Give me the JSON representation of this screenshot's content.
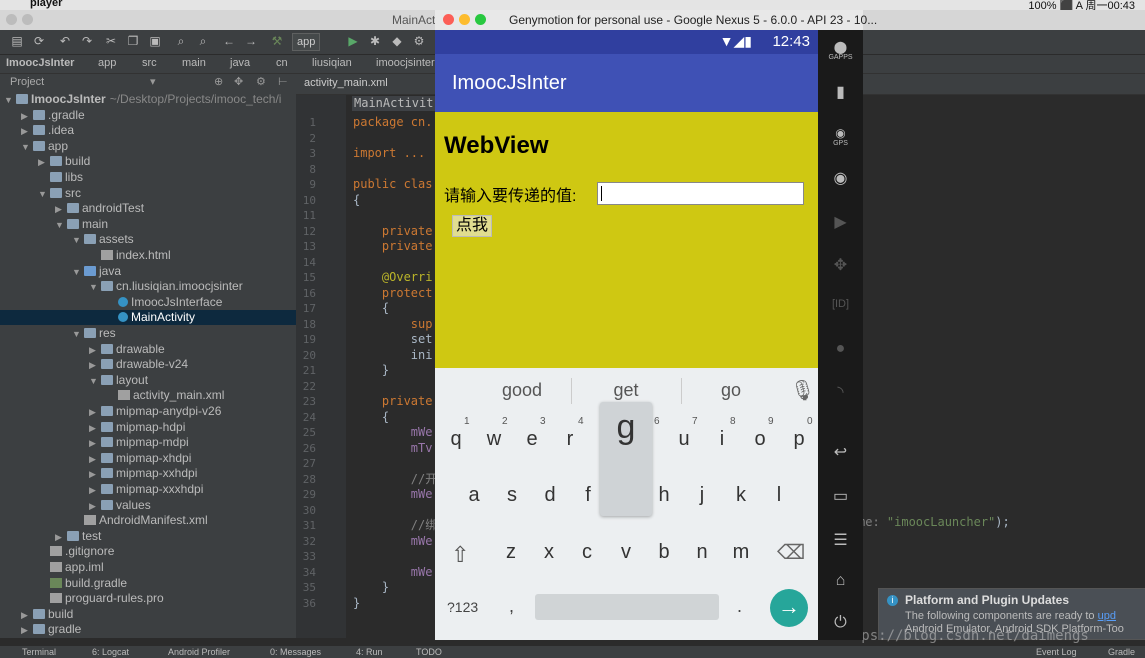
{
  "mac": {
    "app_name": "player",
    "right": "100%  ⬛  A  周一00:43"
  },
  "studio": {
    "window_title": "MainActi"
  },
  "toolbar": {
    "config": "app"
  },
  "breadcrumbs": [
    "ImoocJsInter",
    "app",
    "src",
    "main",
    "java",
    "cn",
    "liusiqian",
    "imoocjsinter"
  ],
  "project": {
    "view_label": "Project",
    "tree": [
      {
        "label": "ImoocJsInter",
        "suffix": "~/Desktop/Projects/imooc_tech/i",
        "depth": 0,
        "arrow": "▼",
        "icon": "folder"
      },
      {
        "label": ".gradle",
        "depth": 1,
        "arrow": "▶",
        "icon": "folder"
      },
      {
        "label": ".idea",
        "depth": 1,
        "arrow": "▶",
        "icon": "folder"
      },
      {
        "label": "app",
        "depth": 1,
        "arrow": "▼",
        "icon": "folder"
      },
      {
        "label": "build",
        "depth": 2,
        "arrow": "▶",
        "icon": "folder"
      },
      {
        "label": "libs",
        "depth": 2,
        "arrow": "",
        "icon": "folder"
      },
      {
        "label": "src",
        "depth": 2,
        "arrow": "▼",
        "icon": "folder"
      },
      {
        "label": "androidTest",
        "depth": 3,
        "arrow": "▶",
        "icon": "folder"
      },
      {
        "label": "main",
        "depth": 3,
        "arrow": "▼",
        "icon": "folder"
      },
      {
        "label": "assets",
        "depth": 4,
        "arrow": "▼",
        "icon": "folder"
      },
      {
        "label": "index.html",
        "depth": 5,
        "arrow": "",
        "icon": "file"
      },
      {
        "label": "java",
        "depth": 4,
        "arrow": "▼",
        "icon": "folder-blue"
      },
      {
        "label": "cn.liusiqian.imoocjsinter",
        "depth": 5,
        "arrow": "▼",
        "icon": "folder"
      },
      {
        "label": "ImoocJsInterface",
        "depth": 6,
        "arrow": "",
        "icon": "class"
      },
      {
        "label": "MainActivity",
        "depth": 6,
        "arrow": "",
        "icon": "class",
        "selected": true
      },
      {
        "label": "res",
        "depth": 4,
        "arrow": "▼",
        "icon": "folder"
      },
      {
        "label": "drawable",
        "depth": 5,
        "arrow": "▶",
        "icon": "folder"
      },
      {
        "label": "drawable-v24",
        "depth": 5,
        "arrow": "▶",
        "icon": "folder"
      },
      {
        "label": "layout",
        "depth": 5,
        "arrow": "▼",
        "icon": "folder"
      },
      {
        "label": "activity_main.xml",
        "depth": 6,
        "arrow": "",
        "icon": "file"
      },
      {
        "label": "mipmap-anydpi-v26",
        "depth": 5,
        "arrow": "▶",
        "icon": "folder"
      },
      {
        "label": "mipmap-hdpi",
        "depth": 5,
        "arrow": "▶",
        "icon": "folder"
      },
      {
        "label": "mipmap-mdpi",
        "depth": 5,
        "arrow": "▶",
        "icon": "folder"
      },
      {
        "label": "mipmap-xhdpi",
        "depth": 5,
        "arrow": "▶",
        "icon": "folder"
      },
      {
        "label": "mipmap-xxhdpi",
        "depth": 5,
        "arrow": "▶",
        "icon": "folder"
      },
      {
        "label": "mipmap-xxxhdpi",
        "depth": 5,
        "arrow": "▶",
        "icon": "folder"
      },
      {
        "label": "values",
        "depth": 5,
        "arrow": "▶",
        "icon": "folder"
      },
      {
        "label": "AndroidManifest.xml",
        "depth": 4,
        "arrow": "",
        "icon": "file"
      },
      {
        "label": "test",
        "depth": 3,
        "arrow": "▶",
        "icon": "folder"
      },
      {
        "label": ".gitignore",
        "depth": 2,
        "arrow": "",
        "icon": "file"
      },
      {
        "label": "app.iml",
        "depth": 2,
        "arrow": "",
        "icon": "file"
      },
      {
        "label": "build.gradle",
        "depth": 2,
        "arrow": "",
        "icon": "file-green"
      },
      {
        "label": "proguard-rules.pro",
        "depth": 2,
        "arrow": "",
        "icon": "file"
      },
      {
        "label": "build",
        "depth": 1,
        "arrow": "▶",
        "icon": "folder"
      },
      {
        "label": "gradle",
        "depth": 1,
        "arrow": "▶",
        "icon": "folder"
      }
    ]
  },
  "editor": {
    "tab": "activity_main.xml",
    "class_hint": "MainActivit",
    "line_numbers": [
      "1",
      "2",
      "3",
      "8",
      "9",
      "10",
      "11",
      "12",
      "13",
      "14",
      "15",
      "16",
      "17",
      "18",
      "19",
      "20",
      "21",
      "22",
      "23",
      "24",
      "25",
      "26",
      "27",
      "28",
      "29",
      "30",
      "31",
      "32",
      "33",
      "34",
      "35",
      "36"
    ],
    "lines": [
      {
        "text": "package cn.",
        "cls": "kw"
      },
      {
        "text": "",
        "cls": ""
      },
      {
        "text": "import ...",
        "cls": "kw"
      },
      {
        "text": "",
        "cls": ""
      },
      {
        "text": "public clas",
        "cls": "kw"
      },
      {
        "text": "{",
        "cls": ""
      },
      {
        "text": "",
        "cls": ""
      },
      {
        "text": "    private",
        "cls": "kw"
      },
      {
        "text": "    private",
        "cls": "kw"
      },
      {
        "text": "",
        "cls": ""
      },
      {
        "text": "    @Overri",
        "cls": "ann"
      },
      {
        "text": "    protect",
        "cls": "kw"
      },
      {
        "text": "    {",
        "cls": ""
      },
      {
        "text": "        sup",
        "cls": "kw"
      },
      {
        "text": "        set",
        "cls": ""
      },
      {
        "text": "        ini",
        "cls": ""
      },
      {
        "text": "    }",
        "cls": ""
      },
      {
        "text": "",
        "cls": ""
      },
      {
        "text": "    private",
        "cls": "kw"
      },
      {
        "text": "    {",
        "cls": ""
      },
      {
        "text": "        mWe",
        "cls": "fld"
      },
      {
        "text": "        mTv",
        "cls": "fld"
      },
      {
        "text": "",
        "cls": ""
      },
      {
        "text": "        //开",
        "cls": "cmt"
      },
      {
        "text": "        mWe",
        "cls": "fld"
      },
      {
        "text": "",
        "cls": ""
      },
      {
        "text": "        //绑",
        "cls": "cmt"
      },
      {
        "text": "        mWe",
        "cls": "fld"
      },
      {
        "text": "",
        "cls": ""
      },
      {
        "text": "        mWe",
        "cls": "fld"
      },
      {
        "text": "    }",
        "cls": ""
      },
      {
        "text": "}",
        "cls": ""
      }
    ],
    "right_snippet_key": "me: ",
    "right_snippet_str": "\"imoocLauncher\"",
    "right_snippet_end": ");"
  },
  "notification": {
    "title": "Platform and Plugin Updates",
    "line1": "The following components are ready to",
    "line1_link": "upd",
    "line2": "Android Emulator, Android SDK Platform-Too"
  },
  "watermark": "https://blog.csdn.net/daimengs",
  "bottom": [
    "Terminal",
    "6: Logcat",
    "Android Profiler",
    "0: Messages",
    "4: Run",
    "TODO",
    "Event Log",
    "Gradle"
  ],
  "geny": {
    "title": "Genymotion for personal use - Google Nexus 5 - 6.0.0 - API 23 - 10...",
    "time": "12:43",
    "app_title": "ImoocJsInter",
    "web_heading": "WebView",
    "web_label": "请输入要传递的值:",
    "web_button": "点我",
    "suggestions": [
      "good",
      "get",
      "go"
    ],
    "row1": [
      "q",
      "w",
      "e",
      "r",
      "t",
      "y",
      "u",
      "i",
      "o",
      "p"
    ],
    "row1_hints": [
      "1",
      "2",
      "3",
      "4",
      "5",
      "6",
      "7",
      "8",
      "9",
      "0"
    ],
    "row2": [
      "a",
      "s",
      "d",
      "f",
      "g",
      "h",
      "j",
      "k",
      "l"
    ],
    "row3": [
      "z",
      "x",
      "c",
      "v",
      "b",
      "n",
      "m"
    ],
    "popup_key": "g",
    "sym_key": "?123",
    "comma": ",",
    "period": "."
  },
  "side_icons": [
    "gapps-icon",
    "battery-icon",
    "gps-icon",
    "camera-icon",
    "video-icon",
    "dpad-icon",
    "id-icon",
    "record-icon",
    "network-icon",
    "back-icon",
    "recents-icon",
    "menu-icon",
    "home-icon",
    "power-icon"
  ],
  "side_labels": {
    "gapps": "GAPPS",
    "gps": "GPS",
    "id": "ID"
  }
}
